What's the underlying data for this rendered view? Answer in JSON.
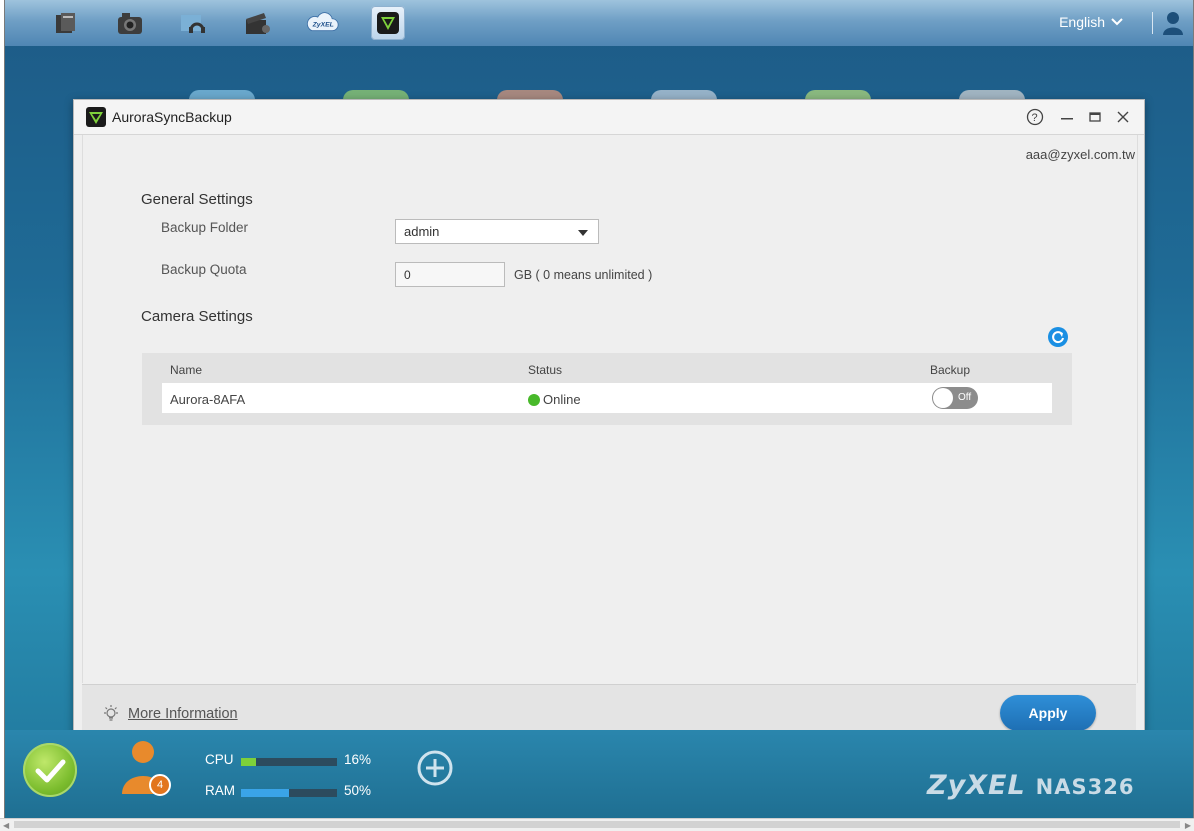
{
  "taskbar": {
    "apps": [
      {
        "name": "file-browser-icon",
        "active": false
      },
      {
        "name": "photo-icon",
        "active": false
      },
      {
        "name": "music-icon",
        "active": false
      },
      {
        "name": "video-icon",
        "active": false
      },
      {
        "name": "zyxel-cloud-icon",
        "active": false,
        "text": "ZyXEL"
      },
      {
        "name": "aurora-sync-icon",
        "active": true
      }
    ],
    "language": "English"
  },
  "window": {
    "title": "AuroraSyncBackup",
    "account": "aaa@zyxel.com.tw",
    "general": {
      "heading": "General Settings",
      "backup_folder_label": "Backup Folder",
      "backup_folder_value": "admin",
      "backup_quota_label": "Backup Quota",
      "backup_quota_value": "0",
      "quota_note": "GB ( 0 means unlimited )"
    },
    "camera": {
      "heading": "Camera Settings",
      "columns": {
        "name": "Name",
        "status": "Status",
        "backup": "Backup"
      },
      "rows": [
        {
          "name": "Aurora-8AFA",
          "status": "Online",
          "backup": "Off"
        }
      ]
    },
    "footer": {
      "more_info": "More Information",
      "apply": "Apply"
    }
  },
  "dock": {
    "user_badge": "4",
    "cpu_label": "CPU",
    "cpu_value": "16%",
    "cpu_fraction": 0.16,
    "ram_label": "RAM",
    "ram_value": "50%",
    "ram_fraction": 0.5,
    "brand": "ZyXEL",
    "model": "NAS326"
  },
  "colors": {
    "accent": "#1a8fe3",
    "online": "#48b92a",
    "cpu_bar": "#7ed03a",
    "ram_bar": "#3aa4e8"
  }
}
